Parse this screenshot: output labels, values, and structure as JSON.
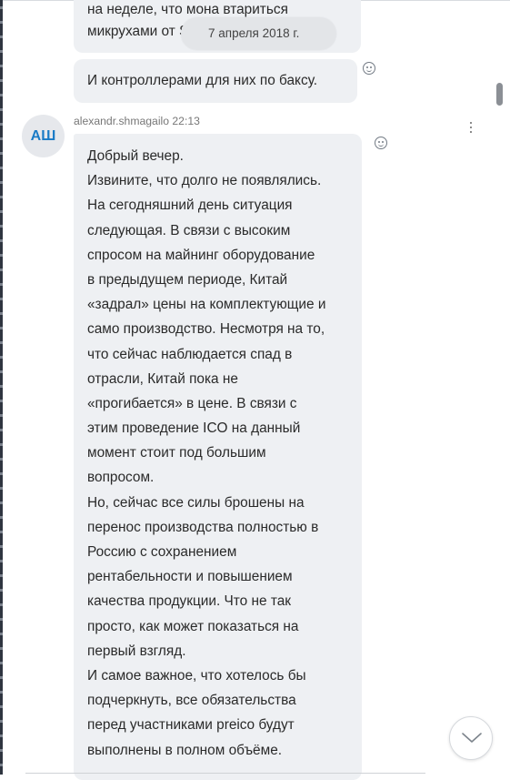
{
  "previous_message": {
    "lines": [
      "на неделе, что мона втариться",
      "микрухами от S9"
    ]
  },
  "date_divider": "7 апреля 2018 г.",
  "message_2": {
    "text": "И контроллерами для них по баксу."
  },
  "sender": {
    "initials": "АШ",
    "name_time": "alexandr.shmagailo 22:13"
  },
  "message_main": {
    "lines": [
      "Добрый вечер.",
      "Извините, что долго не появлялись.",
      "На сегодняшний день ситуация",
      "следующая. В связи с высоким",
      "спросом на майнинг оборудование",
      "в предыдущем периоде, Китай",
      "«задрал» цены на комплектующие и",
      "само производство. Несмотря на то,",
      "что сейчас наблюдается спад в",
      "отрасли, Китай пока не",
      "«прогибается» в цене. В связи с",
      "этим проведение ICO на данный",
      "момент стоит под большим",
      "вопросом.",
      "Но, сейчас все силы брошены на",
      "перенос производства полностью в",
      "Россию с сохранением",
      "рентабельности и повышением",
      "качества продукции. Что не так",
      "просто, как может показаться на",
      "первый взгляд.",
      "И самое важное, что хотелось бы",
      "подчеркнуть, все обязательства",
      "перед участниками preico будут",
      "выполнены в полном объёме."
    ]
  },
  "icons": {
    "reaction": "smiley-icon",
    "more": "more-vertical-icon",
    "scroll_down": "chevron-down-icon"
  }
}
